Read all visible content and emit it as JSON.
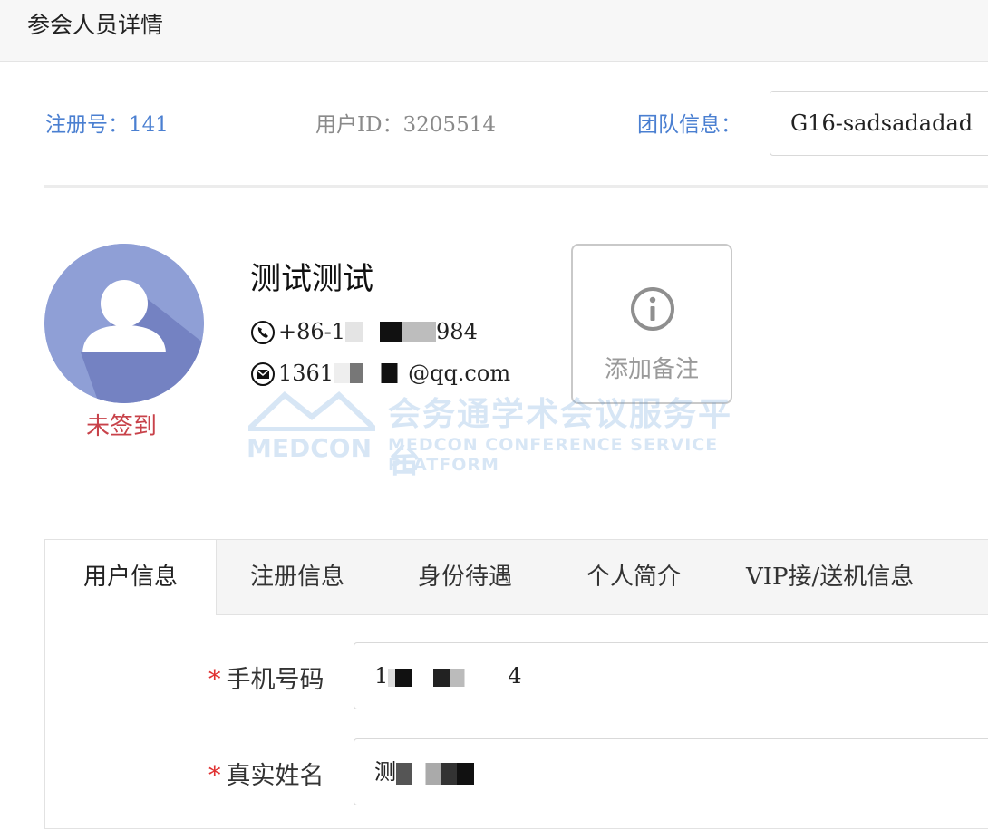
{
  "page": {
    "title": "参会人员详情"
  },
  "info": {
    "reg_label": "注册号：",
    "reg_value": "141",
    "uid_label": "用户ID：",
    "uid_value": "3205514",
    "team_label": "团队信息：",
    "team_value": "G16-sadsadadad"
  },
  "profile": {
    "name": "测试测试",
    "phone_prefix": "+86-1",
    "phone_suffix": "984",
    "email_prefix": "1361",
    "email_suffix": "@qq.com",
    "checkin_status": "未签到"
  },
  "note_button": {
    "label": "添加备注"
  },
  "watermark": {
    "cn": "会务通学术会议服务平台",
    "logo": "MEDCON",
    "en": "MEDCON CONFERENCE SERVICE PLATFORM"
  },
  "tabs": [
    {
      "label": "用户信息",
      "active": true
    },
    {
      "label": "注册信息"
    },
    {
      "label": "身份待遇"
    },
    {
      "label": "个人简介"
    },
    {
      "label": "VIP接/送机信息"
    }
  ],
  "form": {
    "required_mark": "*",
    "phone_label": "手机号码",
    "phone_value_prefix": "1",
    "phone_value_suffix": "4",
    "realname_label": "真实姓名",
    "realname_value_prefix": "测"
  },
  "colors": {
    "accent_blue": "#4a7fd1",
    "status_red": "#c8424a",
    "required_red": "#e03131"
  },
  "icons": [
    "avatar-icon",
    "phone-icon",
    "mail-icon",
    "info-icon"
  ]
}
